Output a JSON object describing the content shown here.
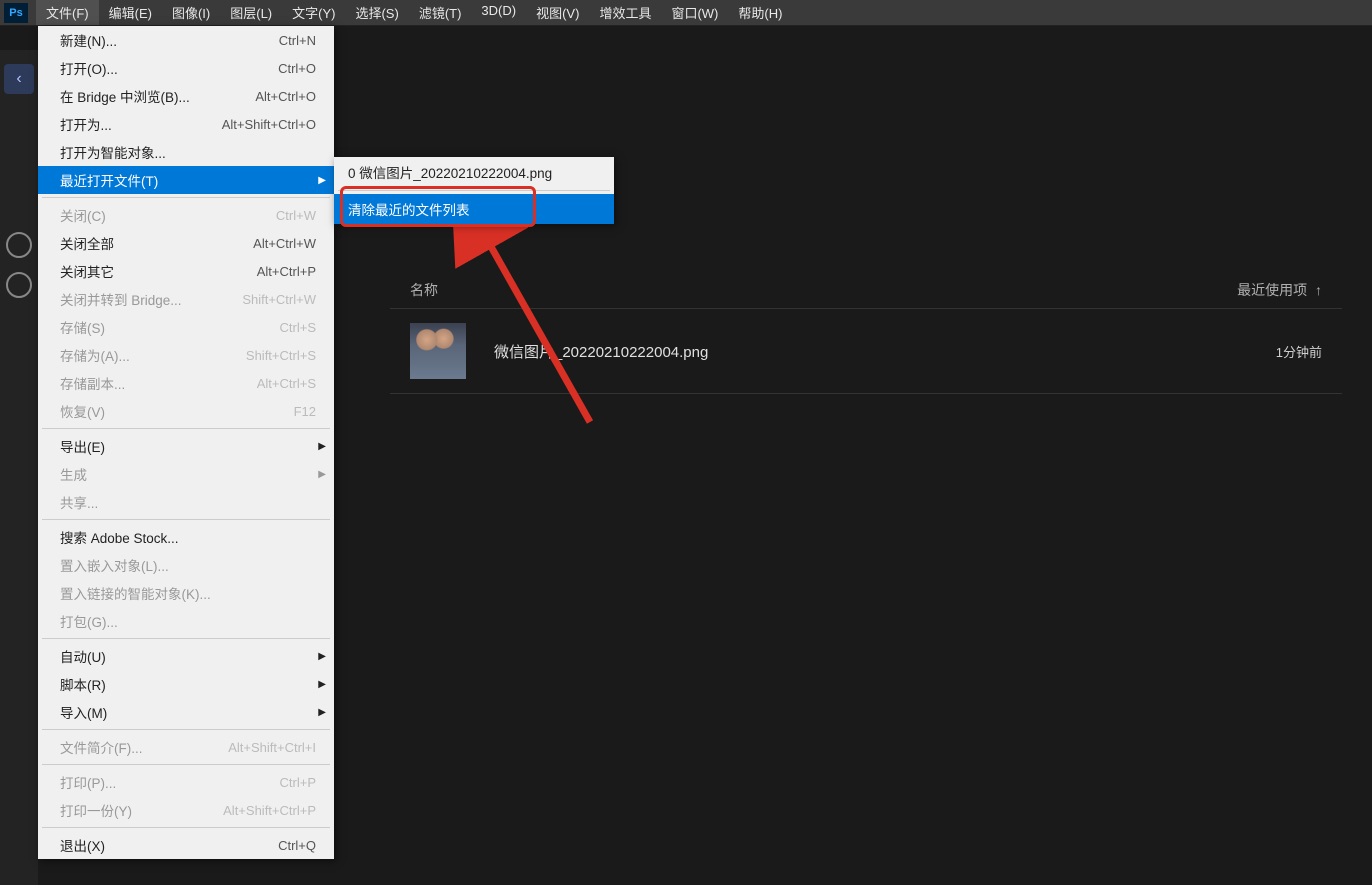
{
  "logo": "Ps",
  "menubar": [
    {
      "key": "file",
      "label": "文件(F)",
      "active": true
    },
    {
      "key": "edit",
      "label": "编辑(E)"
    },
    {
      "key": "image",
      "label": "图像(I)"
    },
    {
      "key": "layer",
      "label": "图层(L)"
    },
    {
      "key": "text",
      "label": "文字(Y)"
    },
    {
      "key": "select",
      "label": "选择(S)"
    },
    {
      "key": "filter",
      "label": "滤镜(T)"
    },
    {
      "key": "3d",
      "label": "3D(D)"
    },
    {
      "key": "view",
      "label": "视图(V)"
    },
    {
      "key": "plugins",
      "label": "增效工具"
    },
    {
      "key": "window",
      "label": "窗口(W)"
    },
    {
      "key": "help",
      "label": "帮助(H)"
    }
  ],
  "dropdown": [
    {
      "label": "新建(N)...",
      "shortcut": "Ctrl+N"
    },
    {
      "label": "打开(O)...",
      "shortcut": "Ctrl+O"
    },
    {
      "label": "在 Bridge 中浏览(B)...",
      "shortcut": "Alt+Ctrl+O"
    },
    {
      "label": "打开为...",
      "shortcut": "Alt+Shift+Ctrl+O"
    },
    {
      "label": "打开为智能对象..."
    },
    {
      "label": "最近打开文件(T)",
      "highlighted": true,
      "submenu": true
    },
    {
      "sep": true
    },
    {
      "label": "关闭(C)",
      "shortcut": "Ctrl+W",
      "disabled": true
    },
    {
      "label": "关闭全部",
      "shortcut": "Alt+Ctrl+W"
    },
    {
      "label": "关闭其它",
      "shortcut": "Alt+Ctrl+P"
    },
    {
      "label": "关闭并转到 Bridge...",
      "shortcut": "Shift+Ctrl+W",
      "disabled": true
    },
    {
      "label": "存储(S)",
      "shortcut": "Ctrl+S",
      "disabled": true
    },
    {
      "label": "存储为(A)...",
      "shortcut": "Shift+Ctrl+S",
      "disabled": true
    },
    {
      "label": "存储副本...",
      "shortcut": "Alt+Ctrl+S",
      "disabled": true
    },
    {
      "label": "恢复(V)",
      "shortcut": "F12",
      "disabled": true
    },
    {
      "sep": true
    },
    {
      "label": "导出(E)",
      "submenu": true
    },
    {
      "label": "生成",
      "submenu": true,
      "disabled": true
    },
    {
      "label": "共享...",
      "disabled": true
    },
    {
      "sep": true
    },
    {
      "label": "搜索 Adobe Stock..."
    },
    {
      "label": "置入嵌入对象(L)...",
      "disabled": true
    },
    {
      "label": "置入链接的智能对象(K)...",
      "disabled": true
    },
    {
      "label": "打包(G)...",
      "disabled": true
    },
    {
      "sep": true
    },
    {
      "label": "自动(U)",
      "submenu": true
    },
    {
      "label": "脚本(R)",
      "submenu": true
    },
    {
      "label": "导入(M)",
      "submenu": true
    },
    {
      "sep": true
    },
    {
      "label": "文件简介(F)...",
      "shortcut": "Alt+Shift+Ctrl+I",
      "disabled": true
    },
    {
      "sep": true
    },
    {
      "label": "打印(P)...",
      "shortcut": "Ctrl+P",
      "disabled": true
    },
    {
      "label": "打印一份(Y)",
      "shortcut": "Alt+Shift+Ctrl+P",
      "disabled": true
    },
    {
      "sep": true
    },
    {
      "label": "退出(X)",
      "shortcut": "Ctrl+Q"
    }
  ],
  "submenu": [
    {
      "label": "0  微信图片_20220210222004.png"
    },
    {
      "sep": true
    },
    {
      "label": "清除最近的文件列表",
      "highlighted": true
    }
  ],
  "table": {
    "headers": {
      "name": "名称",
      "recent": "最近使用项",
      "sort_arrow": "↑"
    },
    "rows": [
      {
        "name": "微信图片_20220210222004.png",
        "time": "1分钟前"
      }
    ]
  }
}
